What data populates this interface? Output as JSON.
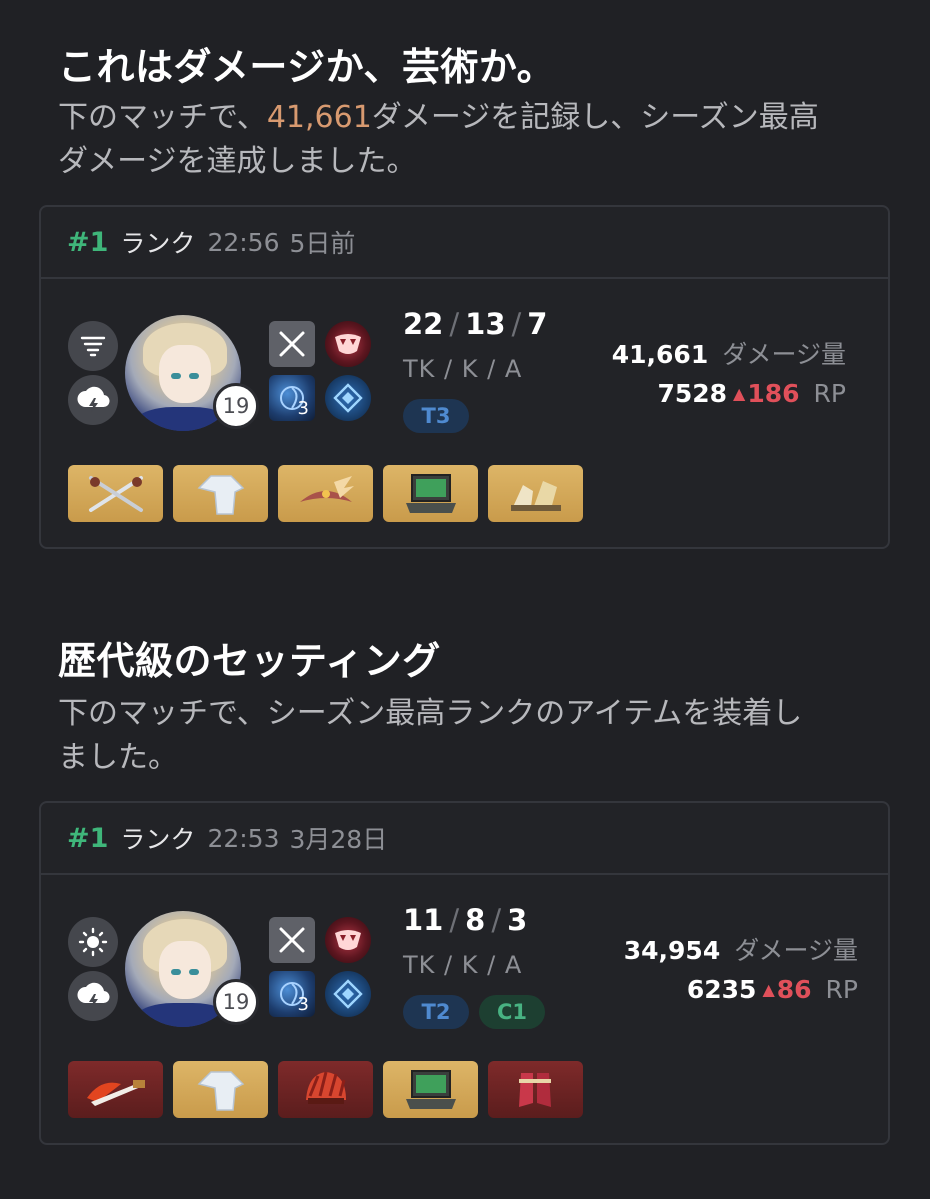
{
  "sections": [
    {
      "title": "これはダメージか、芸術か。",
      "desc_pre": "下のマッチで、",
      "desc_highlight": "41,661",
      "desc_line1_post": "ダメージを記録し、シーズン最高",
      "desc_line2": "ダメージを達成しました。",
      "card": {
        "rank_num": "#1",
        "rank_label": "ランク",
        "time": "22:56",
        "date": "5日前",
        "weather": [
          "fog-icon",
          "thunderstorm-icon"
        ],
        "level": "19",
        "tactical_level": "3",
        "kda_t": "22",
        "kda_k": "13",
        "kda_a": "7",
        "kda_label": "TK / K / A",
        "tags": [
          {
            "text": "T3",
            "color": "blue"
          }
        ],
        "damage": "41,661",
        "damage_label": "ダメージ量",
        "rp": "7528",
        "rp_delta": "186",
        "rp_label": "RP",
        "items": [
          {
            "name": "dual-daggers-icon",
            "grade": "gold"
          },
          {
            "name": "white-cloak-icon",
            "grade": "gold"
          },
          {
            "name": "winged-tiara-icon",
            "grade": "gold"
          },
          {
            "name": "laptop-icon",
            "grade": "gold"
          },
          {
            "name": "golden-boots-icon",
            "grade": "gold"
          }
        ]
      }
    },
    {
      "title": "歴代級のセッティング",
      "desc_line1": "下のマッチで、シーズン最高ランクのアイテムを装着し",
      "desc_line2": "ました。",
      "card": {
        "rank_num": "#1",
        "rank_label": "ランク",
        "time": "22:53",
        "date": "3月28日",
        "weather": [
          "sun-icon",
          "thunderstorm-icon"
        ],
        "level": "19",
        "tactical_level": "3",
        "kda_t": "11",
        "kda_k": "8",
        "kda_a": "3",
        "kda_label": "TK / K / A",
        "tags": [
          {
            "text": "T2",
            "color": "blue"
          },
          {
            "text": "C1",
            "color": "green"
          }
        ],
        "damage": "34,954",
        "damage_label": "ダメージ量",
        "rp": "6235",
        "rp_delta": "86",
        "rp_label": "RP",
        "items": [
          {
            "name": "flame-dagger-icon",
            "grade": "red"
          },
          {
            "name": "white-cloak-icon",
            "grade": "gold"
          },
          {
            "name": "red-feather-helmet-icon",
            "grade": "red"
          },
          {
            "name": "laptop-icon",
            "grade": "gold"
          },
          {
            "name": "red-boots-icon",
            "grade": "red"
          }
        ]
      }
    }
  ],
  "colors": {
    "background": "#202125",
    "highlight": "#d89a70",
    "rank_green": "#3fb67a",
    "rp_up_red": "#e0505a",
    "gold_item": "#d4aa5b",
    "red_item": "#6d2424"
  }
}
